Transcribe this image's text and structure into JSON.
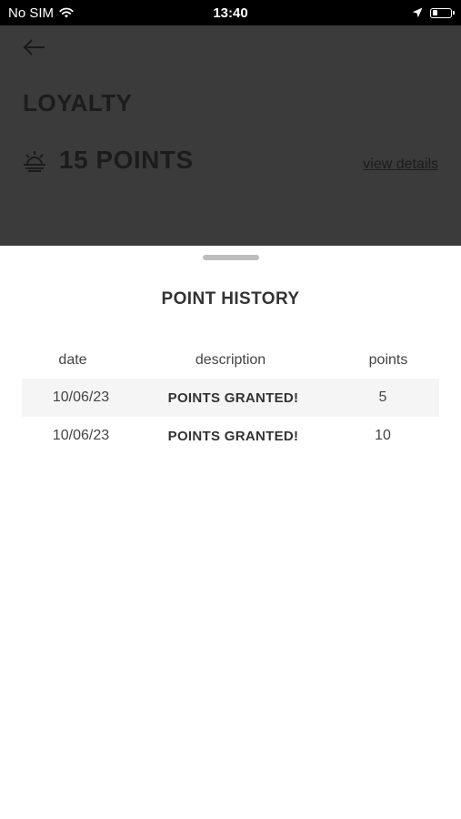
{
  "status_bar": {
    "carrier": "No SIM",
    "time": "13:40",
    "icons": [
      "wifi-icon",
      "location-arrow-icon",
      "battery-icon"
    ],
    "battery_level": 0.25
  },
  "header": {
    "back_icon": "back-arrow-icon",
    "title": "LOYALTY",
    "points_icon": "sun-icon",
    "points_total": "15 POINTS",
    "view_details_label": "view details"
  },
  "sheet": {
    "title": "POINT HISTORY",
    "columns": [
      "date",
      "description",
      "points"
    ],
    "rows": [
      {
        "date": "10/06/23",
        "description": "POINTS GRANTED!",
        "points": "5"
      },
      {
        "date": "10/06/23",
        "description": "POINTS GRANTED!",
        "points": "10"
      }
    ]
  },
  "colors": {
    "backdrop": "#3b3b3b",
    "sheet_background": "#ffffff",
    "row_alt": "#f5f5f5"
  }
}
